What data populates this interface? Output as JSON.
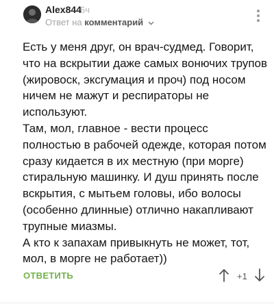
{
  "comment": {
    "author": "Alex844",
    "time": "5ч",
    "reply_prefix": "Ответ на",
    "reply_target": "комментарий",
    "paragraphs": [
      "Есть у меня друг, он врач-судмед. Говорит, что на вскрытии даже самых вонючих трупов (жировоск, эксгумация и проч) под носом ничем не мажут и респираторы не используют.",
      "Там, мол, главное - вести процесс полностью в рабочей одежде, которая потом сразу кидается в их местную (при морге) стиральную машинку. И душ принять после вскрытия, с мытьем головы, ибо волосы (особенно длинные) отлично накапливают трупные миазмы.",
      "А кто к запахам привыкнуть не может, тот, мол, в морге не работает))"
    ]
  },
  "actions": {
    "reply_label": "ОТВЕТИТЬ",
    "rating": "+1"
  },
  "colors": {
    "accent_green": "#74b14b",
    "muted_gray": "#a5a5a5"
  },
  "icons": [
    "avatar",
    "chevron-down-icon",
    "more-vertical-icon",
    "arrow-up-icon",
    "arrow-down-icon"
  ]
}
